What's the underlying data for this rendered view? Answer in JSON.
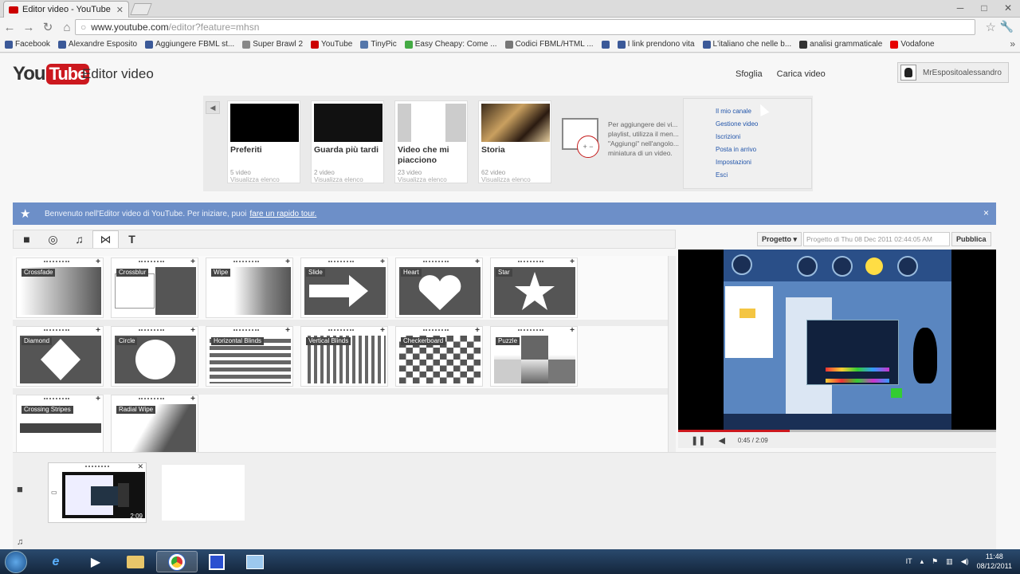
{
  "browser": {
    "tab_title": "Editor video - YouTube",
    "url_host": "www.youtube.com",
    "url_path": "/editor?feature=mhsn",
    "bookmarks": [
      "Facebook",
      "Alexandre Esposito",
      "Aggiungere FBML st...",
      "Super Brawl 2",
      "YouTube",
      "TinyPic",
      "Easy Cheapy: Come ...",
      "Codici FBML/HTML ...",
      "",
      "I link prendono vita",
      "L'italiano che nelle b...",
      "analisi grammaticale",
      "Vodafone"
    ],
    "bookmark_colors": [
      "#3b5998",
      "#3b5998",
      "#3b5998",
      "#888888",
      "#cc0000",
      "#5577aa",
      "#44aa44",
      "#777777",
      "#3b5998",
      "#3b5998",
      "#3b5998",
      "#333333",
      "#e60000"
    ]
  },
  "header": {
    "logo_you": "You",
    "logo_tube": "Tube",
    "title": "Editor video",
    "link_browse": "Sfoglia",
    "link_upload": "Carica video",
    "username": "MrEspositoalessandro"
  },
  "playlists": [
    {
      "name": "Preferiti",
      "count": "5 video",
      "link": "Visualizza elenco"
    },
    {
      "name": "Guarda più tardi",
      "count": "2 video",
      "link": "Visualizza elenco"
    },
    {
      "name": "Video che mi piacciono",
      "count": "23 video",
      "link": "Visualizza elenco"
    },
    {
      "name": "Storia",
      "count": "62 video",
      "link": "Visualizza elenco"
    }
  ],
  "playlist_hint": "Per aggiungere dei vi... playlist, utilizza il men... \"Aggiungi\" nell'angolo... miniatura di un video.",
  "user_menu": [
    "Il mio canale",
    "Gestione video",
    "Iscrizioni",
    "Posta in arrivo",
    "Impostazioni",
    "Esci"
  ],
  "welcome": {
    "text": "Benvenuto nell'Editor video di YouTube. Per iniziare, puoi",
    "link": "fare un rapido tour.",
    "close": "×"
  },
  "editor_tabs": [
    "video-camera-icon",
    "cc-icon",
    "music-icon",
    "transition-icon",
    "text-icon"
  ],
  "project": {
    "menu_label": "Progetto ▾",
    "name_value": "Progetto di Thu 08 Dec 2011 02:44:05 AM",
    "publish_label": "Pubblica"
  },
  "transitions": [
    {
      "label": "Crossfade",
      "kind": "crossfade"
    },
    {
      "label": "Crossblur",
      "kind": "crossblur"
    },
    {
      "label": "Wipe",
      "kind": "wipe"
    },
    {
      "label": "Slide",
      "kind": "slide"
    },
    {
      "label": "Heart",
      "kind": "heart"
    },
    {
      "label": "Star",
      "kind": "star"
    },
    {
      "label": "Diamond",
      "kind": "diamond"
    },
    {
      "label": "Circle",
      "kind": "circle"
    },
    {
      "label": "Horizontal Blinds",
      "kind": "hblinds"
    },
    {
      "label": "Vertical Blinds",
      "kind": "vblinds"
    },
    {
      "label": "Checkerboard",
      "kind": "checker"
    },
    {
      "label": "Puzzle",
      "kind": "puzzle"
    },
    {
      "label": "Crossing Stripes",
      "kind": "stripes"
    },
    {
      "label": "Radial Wipe",
      "kind": "radial"
    }
  ],
  "player": {
    "time": "0:45 / 2:09",
    "progress": 0.35
  },
  "timeline": {
    "clip_duration": "2:09"
  },
  "taskbar": {
    "language": "IT",
    "time": "11:48",
    "date": "08/12/2011"
  }
}
